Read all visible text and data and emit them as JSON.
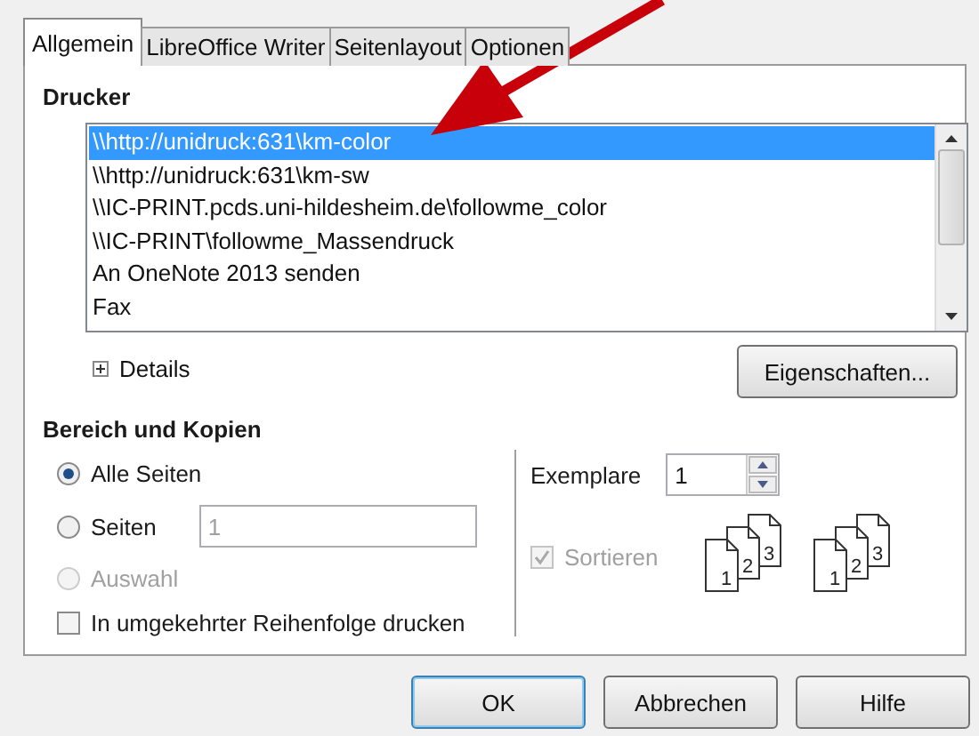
{
  "tabs": [
    {
      "label": "Allgemein",
      "selected": true
    },
    {
      "label": "LibreOffice Writer",
      "selected": false
    },
    {
      "label": "Seitenlayout",
      "selected": false
    },
    {
      "label": "Optionen",
      "selected": false
    }
  ],
  "printer": {
    "heading": "Drucker",
    "items": [
      {
        "label": "\\\\http://unidruck:631\\km-color",
        "selected": true
      },
      {
        "label": "\\\\http://unidruck:631\\km-sw",
        "selected": false
      },
      {
        "label": "\\\\IC-PRINT.pcds.uni-hildesheim.de\\followme_color",
        "selected": false
      },
      {
        "label": "\\\\IC-PRINT\\followme_Massendruck",
        "selected": false
      },
      {
        "label": "An OneNote 2013 senden",
        "selected": false
      },
      {
        "label": "Fax",
        "selected": false
      }
    ],
    "details": {
      "label": "Details",
      "expanded": false
    },
    "properties_button": "Eigenschaften..."
  },
  "range": {
    "heading": "Bereich und Kopien",
    "options": [
      {
        "kind": "radio",
        "label": "Alle Seiten",
        "selected": true,
        "disabled": false
      },
      {
        "kind": "radio_field",
        "label": "Seiten",
        "selected": false,
        "disabled": false,
        "value": "1"
      },
      {
        "kind": "radio",
        "label": "Auswahl",
        "selected": false,
        "disabled": true
      },
      {
        "kind": "checkbox",
        "label": "In umgekehrter Reihenfolge drucken",
        "checked": false,
        "disabled": false
      }
    ]
  },
  "copies": {
    "label": "Exemplare",
    "value": "1",
    "collate": {
      "label": "Sortieren",
      "checked": true,
      "disabled": true
    },
    "collate_icons": [
      {
        "pages": [
          "1",
          "2",
          "3"
        ]
      },
      {
        "pages": [
          "1",
          "2",
          "3"
        ]
      }
    ]
  },
  "buttons": [
    {
      "label": "OK",
      "default": true
    },
    {
      "label": "Abbrechen",
      "default": false
    },
    {
      "label": "Hilfe",
      "default": false
    }
  ],
  "annotation": {
    "kind": "arrow",
    "color": "#c8000a"
  }
}
